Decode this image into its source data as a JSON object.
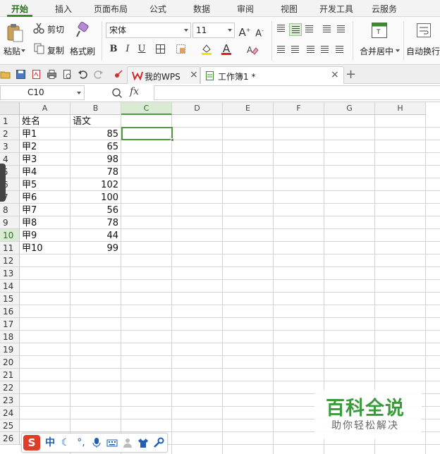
{
  "menu": {
    "tabs": [
      "开始",
      "插入",
      "页面布局",
      "公式",
      "数据",
      "审阅",
      "视图",
      "开发工具",
      "云服务"
    ],
    "active": "开始"
  },
  "toolbar": {
    "paste_label": "粘贴",
    "cut_label": "剪切",
    "copy_label": "复制",
    "format_painter_label": "格式刷",
    "font_name": "宋体",
    "font_size": "11",
    "grow_font": "A",
    "shrink_font": "A",
    "bold": "B",
    "italic": "I",
    "underline": "U",
    "font_color_letter": "A",
    "merge_center_label": "合并居中",
    "wrap_text_label": "自动换行",
    "accent_color": "#3c8c2b"
  },
  "doc_tabs": [
    {
      "label": "我的WPS",
      "active": false
    },
    {
      "label": "工作簿1 *",
      "active": true
    }
  ],
  "formula_bar": {
    "name_box": "C10",
    "fx_label": "fx",
    "value": ""
  },
  "sheet": {
    "columns": [
      "A",
      "B",
      "C",
      "D",
      "E",
      "F",
      "G",
      "H"
    ],
    "active_column": "C",
    "rows": [
      "1",
      "2",
      "3",
      "4",
      "5",
      "6",
      "7",
      "8",
      "9",
      "10",
      "11",
      "12",
      "13",
      "14",
      "15",
      "16",
      "17",
      "18",
      "19",
      "20",
      "21",
      "22",
      "23",
      "24",
      "25",
      "26"
    ],
    "active_row": "10",
    "data": [
      [
        "姓名",
        "语文"
      ],
      [
        "甲1",
        "85"
      ],
      [
        "甲2",
        "65"
      ],
      [
        "甲3",
        "98"
      ],
      [
        "甲4",
        "78"
      ],
      [
        "甲5",
        "102"
      ],
      [
        "甲6",
        "100"
      ],
      [
        "甲7",
        "56"
      ],
      [
        "甲8",
        "78"
      ],
      [
        "甲9",
        "44"
      ],
      [
        "甲10",
        "99"
      ]
    ]
  },
  "ime": {
    "mode_label": "中"
  },
  "watermark": {
    "title": "百科全说",
    "subtitle": "助你轻松解决"
  }
}
